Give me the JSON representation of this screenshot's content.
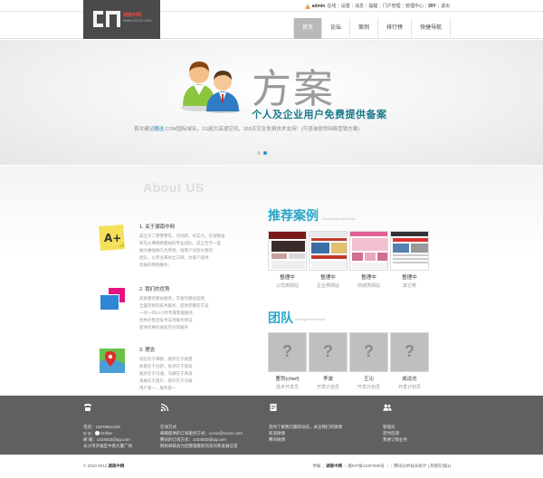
{
  "userbar": {
    "links": [
      "admin",
      "在线",
      "设置",
      "消息",
      "提醒",
      "门户管理",
      "管理中心",
      "DIY",
      "退出"
    ]
  },
  "logo": {
    "name": "湖南中网",
    "url": "www.cccsc.com"
  },
  "nav": {
    "items": [
      "首页",
      "论坛",
      "案例",
      "排行榜",
      "快捷导航"
    ],
    "active_index": 0
  },
  "banner": {
    "title": "方案",
    "subtitle": "个人及企业用户免费提供备案",
    "desc_before": "首次建站",
    "desc_highlight": "赠送",
    "desc_after": ".COM国际域名，1G超大高速空间，365天完全免费技术支持！(可咨询提供网络营销方案)",
    "slide_count": 2,
    "active_slide": 1
  },
  "about": {
    "title": "About US",
    "features": [
      {
        "heading": "1. 关于湖南中网",
        "icon": "aplus-note-icon",
        "lines": [
          "成立于二零零零年，为创新、有实力，在湖南省",
          "率先从事网络建站的专业团队，成立至今一直",
          "做大做强做久为原则，给客户创造价值的",
          "团队，以专业来树立口碑，为客户提供",
          "优质的网络服务。"
        ]
      },
      {
        "heading": "2. 我们的优势",
        "icon": "cards-icon",
        "lines": [
          "高质量的建站服务，丰富的建站案例",
          "全面完善的技术服务，提供完整的方案",
          "一对一的24小时专属客服服务",
          "优秀的售后技术支持服务保证",
          "提供优惠的域名空间等服务"
        ]
      },
      {
        "heading": "3. 理念",
        "icon": "map-pin-icon",
        "lines": [
          "诚信在于细致，服务在于质量",
          "质量在于创新，技术在于提高",
          "服务在于沟通，沟通在于真诚",
          "发展在于提升，提升在于沟通",
          "用户第一，服务第一"
        ]
      }
    ]
  },
  "cases": {
    "title": "推荐案例",
    "subtitle": "Recommended case",
    "items": [
      {
        "title": "整理中",
        "category": "公司类网站"
      },
      {
        "title": "整理中",
        "category": "企业类网站"
      },
      {
        "title": "整理中",
        "category": "商城类网站"
      },
      {
        "title": "整理中",
        "category": "其它类"
      }
    ]
  },
  "team": {
    "title": "团队",
    "subtitle": "Management team",
    "members": [
      {
        "name": "曹剑(chief)",
        "role": "技术开发员"
      },
      {
        "name": "李波",
        "role": "开发计划员"
      },
      {
        "name": "王沁",
        "role": "开发计划员"
      },
      {
        "name": "成运志",
        "role": "开发计划员"
      }
    ]
  },
  "footer": {
    "contact": {
      "phone": "电话：15575811333",
      "qq_label": "Q Q：",
      "qq_status": "Online",
      "email": "邮 箱：1424933@qq.com",
      "address": "长沙市开福区中南大厦广场"
    },
    "subscribe": {
      "heading": "在线方式",
      "lines": [
        "邮箱提供的订阅服务方式：cccsc@cccsc.com",
        "腾讯的订阅方式：1424933@qq.com",
        "网易邮箱会为您整理最新的资讯和发展信息"
      ]
    },
    "news": {
      "lines": [
        "及时了解我们最新动态，关注我们的微博",
        "新浪微博",
        "腾讯微博"
      ]
    },
    "members": {
      "lines": [
        "管理员",
        "定时后期",
        "我要订购业务"
      ]
    }
  },
  "bottom": {
    "copyright": "© 2010-2012",
    "brand": "湖南中网",
    "links": [
      "举报",
      "湖南中网",
      "湘ICP备11007590号",
      "腾讯分析站长统计 | 热图在线[1]"
    ]
  },
  "colors": {
    "accent": "#2aa6c8",
    "banner_subtitle": "#1a7a8c",
    "footer_bg": "#606060",
    "nav_active": "#b9b9b9"
  }
}
